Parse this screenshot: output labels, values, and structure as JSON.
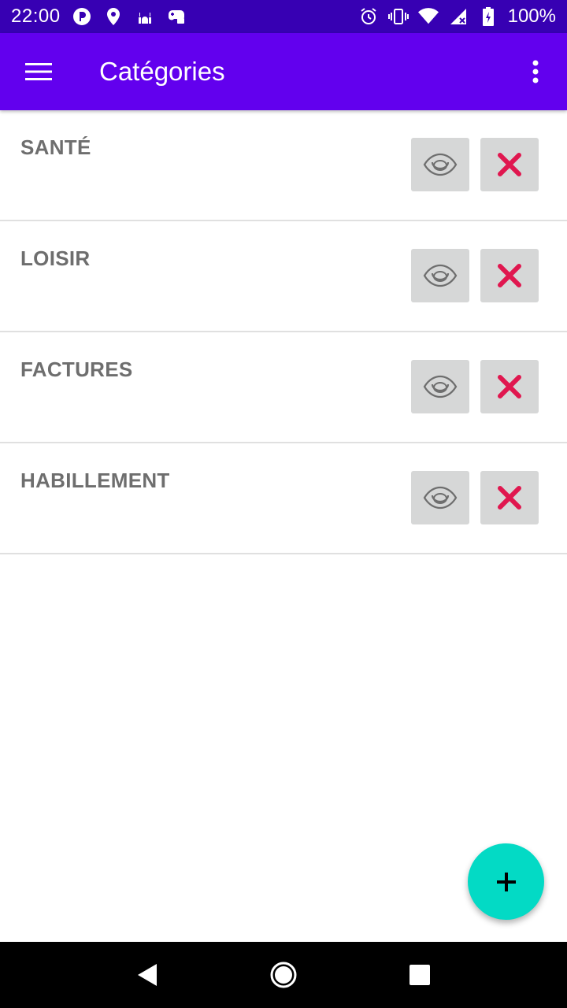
{
  "status_bar": {
    "time": "22:00",
    "battery": "100%",
    "left_icons": [
      "pocket-icon",
      "location-icon",
      "mosque-icon",
      "game-controller-icon"
    ],
    "right_icons": [
      "alarm-icon",
      "vibrate-icon",
      "wifi-icon",
      "signal-icon",
      "battery-icon"
    ]
  },
  "app_bar": {
    "title": "Catégories",
    "menu_icon": "hamburger-menu-icon",
    "overflow_icon": "more-vert-icon",
    "color": "#6200ee"
  },
  "categories": [
    {
      "label": "SANTÉ"
    },
    {
      "label": "LOISIR"
    },
    {
      "label": "FACTURES"
    },
    {
      "label": "HABILLEMENT"
    }
  ],
  "row_actions": {
    "view_icon": "eye-icon",
    "delete_icon": "close-x-icon",
    "delete_color": "#e0174f"
  },
  "fab": {
    "icon": "plus-icon",
    "color": "#03dac5"
  },
  "nav_bar": {
    "buttons": [
      "back-icon",
      "home-icon",
      "recents-icon"
    ]
  }
}
